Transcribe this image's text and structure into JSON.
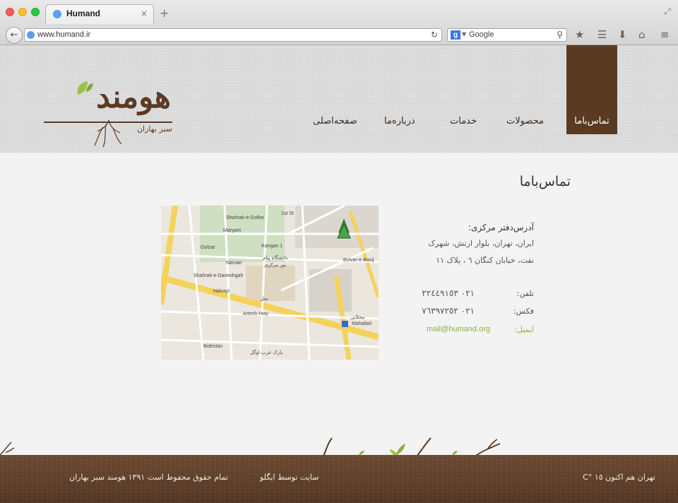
{
  "browser": {
    "tab_title": "Humand",
    "tab_close": "×",
    "new_tab": "+",
    "url": "www.humand.ir",
    "search_engine_letter": "g",
    "search_placeholder": "Google",
    "icons": [
      "back-arrow-icon",
      "reload-icon",
      "search-icon",
      "star-icon",
      "reading-list-icon",
      "download-icon",
      "home-icon",
      "menu-icon",
      "fullscreen-icon"
    ]
  },
  "logo": {
    "word": "هومند",
    "subtitle": "سبز بهاران"
  },
  "nav": {
    "items": [
      {
        "label": "تماس‌باما",
        "active": true
      },
      {
        "label": "محصولات",
        "active": false
      },
      {
        "label": "خدمات",
        "active": false
      },
      {
        "label": "درباره‌ما",
        "active": false
      },
      {
        "label": "صفحه‌اصلی",
        "active": false
      }
    ]
  },
  "contact": {
    "title": "تماس‌باما",
    "address_heading": "آدرس‌دفتر مرکزی:",
    "address_lines": [
      "ایران، تهران، بلوار ارتش، شهرک",
      "نفت، خیابان کنگان ٦ ، پلاک ١١"
    ],
    "phone_label": "تلفن:",
    "phone_value": "٠٢١ ٢٢٤٤٩١٥٣",
    "fax_label": "فکس:",
    "fax_value": "٠٢١ ٧٦٣٩٧٢٥٢",
    "email_label": "ایمیل:",
    "email_value": "mail@humand.org"
  },
  "map": {
    "labels": [
      "Shahrak-e-Golha",
      "1st St",
      "Maryam",
      "Golzar",
      "Narvan",
      "Shahrak-e-Daneshgah",
      "Halvayi",
      "Artesh Hwy",
      "Kangan 1",
      "Bolvar-e-Basij",
      "Mahallati",
      "Bidestan",
      "دانشگاه پیام",
      "نور مرکزی",
      "پارک عرب اوگل",
      "محلاتی",
      "نجل"
    ]
  },
  "footer": {
    "weather": "تهران هم اکنون  ١٥ °C",
    "credit": "سایت توسط ایگلو",
    "copyright": "تمام حقوق محفوظ است ١٣٩١  هومند سبز بهاران"
  },
  "colors": {
    "brown": "#5a3b22",
    "green": "#8bb043",
    "soil": "#5e3f2a"
  }
}
